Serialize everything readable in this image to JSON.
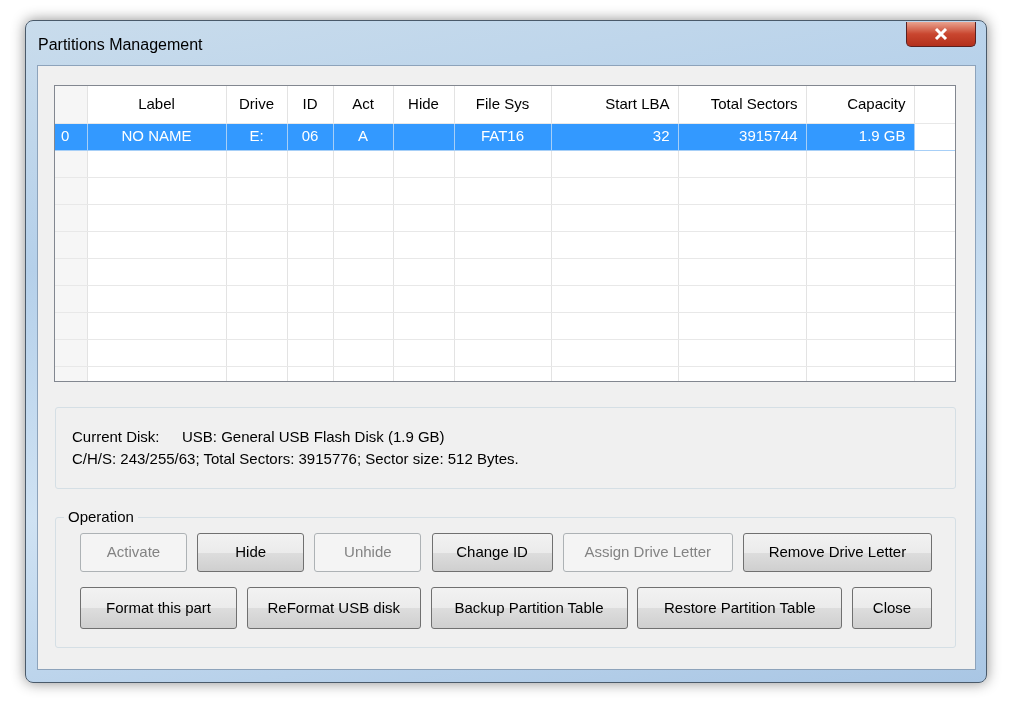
{
  "window": {
    "title": "Partitions Management"
  },
  "table": {
    "columns": [
      "",
      "Label",
      "Drive",
      "ID",
      "Act",
      "Hide",
      "File Sys",
      "Start LBA",
      "Total Sectors",
      "Capacity"
    ],
    "rows": [
      {
        "selected": true,
        "cells": [
          "0",
          "NO NAME",
          "E:",
          "06",
          "A",
          "",
          "FAT16",
          "32",
          "3915744",
          "1.9 GB"
        ]
      }
    ]
  },
  "disk_info": {
    "label": "Current Disk:",
    "value": "USB: General USB Flash Disk (1.9 GB)",
    "geometry": "C/H/S: 243/255/63; Total Sectors: 3915776; Sector size: 512 Bytes."
  },
  "operation": {
    "title": "Operation",
    "button_rows": [
      [
        {
          "label": "Activate",
          "disabled": true
        },
        {
          "label": "Hide",
          "disabled": false
        },
        {
          "label": "Unhide",
          "disabled": true
        },
        {
          "label": "Change ID",
          "disabled": false
        },
        {
          "label": "Assign Drive Letter",
          "disabled": true
        },
        {
          "label": "Remove Drive Letter",
          "disabled": false
        }
      ],
      [
        {
          "label": "Format this part",
          "disabled": false
        },
        {
          "label": "ReFormat USB disk",
          "disabled": false
        },
        {
          "label": "Backup Partition Table",
          "disabled": false
        },
        {
          "label": "Restore Partition Table",
          "disabled": false
        },
        {
          "label": "Close",
          "disabled": false
        }
      ]
    ]
  }
}
